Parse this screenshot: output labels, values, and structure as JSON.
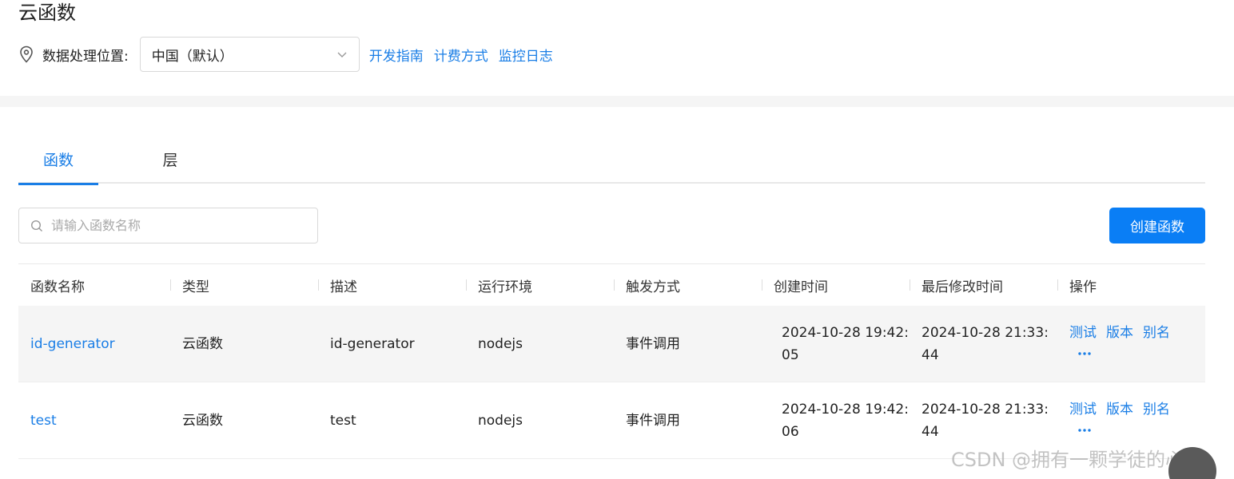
{
  "page": {
    "title": "云函数"
  },
  "region": {
    "label": "数据处理位置:",
    "selected": "中国（默认）",
    "links": [
      "开发指南",
      "计费方式",
      "监控日志"
    ]
  },
  "tabs": [
    {
      "label": "函数",
      "active": true
    },
    {
      "label": "层",
      "active": false
    }
  ],
  "search": {
    "placeholder": "请输入函数名称"
  },
  "create_button": "创建函数",
  "table": {
    "headers": [
      "函数名称",
      "类型",
      "描述",
      "运行环境",
      "触发方式",
      "创建时间",
      "最后修改时间",
      "操作"
    ],
    "rows": [
      {
        "name": "id-generator",
        "type": "云函数",
        "description": "id-generator",
        "runtime": "nodejs",
        "trigger": "事件调用",
        "created_line1": "2024-10-28 19:42:",
        "created_line2": "05",
        "modified_line1": "2024-10-28 21:33:",
        "modified_line2": "44",
        "actions": [
          "测试",
          "版本",
          "别名"
        ]
      },
      {
        "name": "test",
        "type": "云函数",
        "description": "test",
        "runtime": "nodejs",
        "trigger": "事件调用",
        "created_line1": "2024-10-28 19:42:",
        "created_line2": "06",
        "modified_line1": "2024-10-28 21:33:",
        "modified_line2": "44",
        "actions": [
          "测试",
          "版本",
          "别名"
        ]
      }
    ]
  },
  "watermark": "CSDN @拥有一颗学徒的心",
  "colors": {
    "accent": "#1a7ee6",
    "button": "#0a7ef5"
  }
}
